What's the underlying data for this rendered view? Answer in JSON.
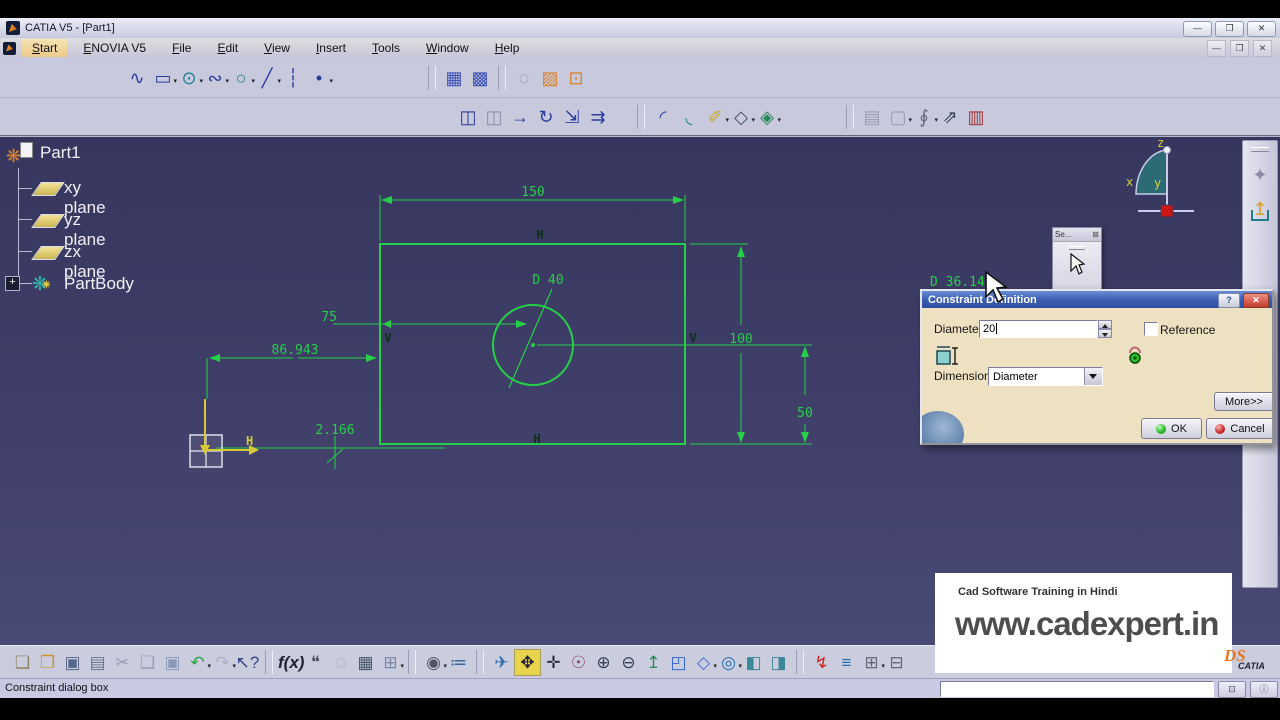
{
  "window": {
    "title": "CATIA V5 - [Part1]",
    "minimize": "—",
    "restore": "❐",
    "close": "✕"
  },
  "doc_window": {
    "minimize": "—",
    "restore": "❐",
    "close": "✕"
  },
  "menu": {
    "items": [
      {
        "name": "menu-start",
        "label": "Start",
        "cls": "active"
      },
      {
        "name": "menu-enovia",
        "label": "ENOVIA V5"
      },
      {
        "name": "menu-file",
        "label": "File"
      },
      {
        "name": "menu-edit",
        "label": "Edit"
      },
      {
        "name": "menu-view",
        "label": "View"
      },
      {
        "name": "menu-insert",
        "label": "Insert"
      },
      {
        "name": "menu-tools",
        "label": "Tools"
      },
      {
        "name": "menu-window",
        "label": "Window"
      },
      {
        "name": "menu-help",
        "label": "Help"
      }
    ]
  },
  "toolbars": {
    "sketch_profile": [
      {
        "name": "profile-icon",
        "glyph": "∿",
        "color": "#2a3c9e"
      },
      {
        "name": "rectangle-icon",
        "glyph": "▭",
        "color": "#2a3c9e",
        "cls": "dd"
      },
      {
        "name": "circle-icon",
        "glyph": "⊙",
        "color": "#1f7d8c",
        "cls": "dd"
      },
      {
        "name": "spline-icon",
        "glyph": "∾",
        "color": "#2a3c9e",
        "cls": "dd"
      },
      {
        "name": "ellipse-icon",
        "glyph": "○",
        "color": "#1f7d8c",
        "cls": "dd"
      },
      {
        "name": "line-icon",
        "glyph": "╱",
        "color": "#2a3c9e",
        "cls": "dd"
      },
      {
        "name": "axis-icon",
        "glyph": "┆",
        "color": "#2a3c9e"
      },
      {
        "name": "point-icon",
        "glyph": "•",
        "color": "#2a3c9e",
        "cls": "dd"
      },
      {
        "sep": true,
        "cls": "gap1"
      },
      {
        "name": "grid-icon",
        "glyph": "▦",
        "color": "#3a50b4"
      },
      {
        "name": "snap-to-point-icon",
        "glyph": "▩",
        "color": "#3a50b4"
      },
      {
        "sep": true
      },
      {
        "name": "construction-element-icon",
        "glyph": "◌",
        "color": "#8a8aa0"
      },
      {
        "name": "diagnostics-icon",
        "glyph": "▨",
        "color": "#d9822b"
      },
      {
        "name": "sketch-analysis-icon",
        "glyph": "⊡",
        "color": "#d9822b"
      }
    ],
    "operation": [
      {
        "name": "mirror-icon",
        "glyph": "◫",
        "color": "#2a3c9e"
      },
      {
        "name": "symmetry-icon",
        "glyph": "◫",
        "color": "#8890ac"
      },
      {
        "name": "translate-icon",
        "glyph": "→",
        "color": "#2a3c9e"
      },
      {
        "name": "rotate-icon",
        "glyph": "↻",
        "color": "#2a3c9e"
      },
      {
        "name": "scale-icon",
        "glyph": "⇲",
        "color": "#2a3c9e"
      },
      {
        "name": "offset-icon",
        "glyph": "⇉",
        "color": "#2a3c9e"
      },
      {
        "sep": true,
        "cls": "gap2"
      },
      {
        "name": "corner-icon",
        "glyph": "◜",
        "color": "#2a3c9e"
      },
      {
        "name": "chamfer-icon",
        "glyph": "◟",
        "color": "#1f7d8c"
      },
      {
        "name": "trim-icon",
        "glyph": "✐",
        "color": "#c8a828",
        "cls": "dd"
      },
      {
        "name": "constraint-icon",
        "glyph": "◇",
        "color": "#445566",
        "cls": "dd"
      },
      {
        "name": "animate-constraint-icon",
        "glyph": "◈",
        "color": "#2a8858",
        "cls": "dd"
      },
      {
        "sep": true,
        "cls": "gap3"
      },
      {
        "name": "catalog-icon",
        "glyph": "▤",
        "color": "#9a9ab0"
      },
      {
        "name": "parameters-icon",
        "glyph": "▢",
        "color": "#9a9ab0",
        "cls": "dd"
      },
      {
        "name": "attach-icon",
        "glyph": "∮",
        "color": "#666677",
        "cls": "dd"
      },
      {
        "name": "output-feature-icon",
        "glyph": "⇗",
        "color": "#334455"
      },
      {
        "name": "datum-icon",
        "glyph": "▥",
        "color": "#a03838"
      }
    ],
    "standard_view": [
      {
        "name": "new-icon",
        "glyph": "❏",
        "color": "#88885e"
      },
      {
        "name": "open-icon",
        "glyph": "❐",
        "color": "#c8962a"
      },
      {
        "name": "save-icon",
        "glyph": "▣",
        "color": "#556688"
      },
      {
        "name": "print-icon",
        "glyph": "▤",
        "color": "#667788"
      },
      {
        "name": "cut-icon",
        "glyph": "✂",
        "color": "#9a9ab0"
      },
      {
        "name": "copy-icon",
        "glyph": "❑",
        "color": "#9a9ab0"
      },
      {
        "name": "paste-icon",
        "glyph": "▣",
        "color": "#8898b8"
      },
      {
        "name": "undo-icon",
        "glyph": "↶",
        "color": "#28a048",
        "cls": "dd"
      },
      {
        "name": "redo-icon",
        "glyph": "↷",
        "color": "#b0b0c4",
        "cls": "dd"
      },
      {
        "name": "whats-this-icon",
        "glyph": "↖?",
        "color": "#334488",
        "cls": "w2"
      },
      {
        "sep": true
      },
      {
        "name": "formula-icon",
        "glyph": "f(x)",
        "color": "#222233",
        "cls": "fx"
      },
      {
        "name": "knowledge-icon",
        "glyph": "❝",
        "color": "#555566"
      },
      {
        "name": "knowledge-inspector-icon",
        "glyph": "☺",
        "color": "#b0b0c4"
      },
      {
        "name": "design-table-icon",
        "glyph": "▦",
        "color": "#445566"
      },
      {
        "name": "structure-icon",
        "glyph": "⊞",
        "color": "#7788aa",
        "cls": "dd"
      },
      {
        "sep": true
      },
      {
        "name": "lock-icon",
        "glyph": "◉",
        "color": "#555566",
        "cls": "dd"
      },
      {
        "name": "check-rules-icon",
        "glyph": "≔",
        "color": "#336699"
      },
      {
        "sep": true
      },
      {
        "name": "fly-mode-icon",
        "glyph": "✈",
        "color": "#2a6fb0"
      },
      {
        "name": "fit-all-icon",
        "glyph": "✥",
        "color": "#222233",
        "cls": "ybg"
      },
      {
        "name": "pan-icon",
        "glyph": "✛",
        "color": "#222233"
      },
      {
        "name": "rotate-view-icon",
        "glyph": "☉",
        "color": "#884466"
      },
      {
        "name": "zoom-in-icon",
        "glyph": "⊕",
        "color": "#334455"
      },
      {
        "name": "zoom-out-icon",
        "glyph": "⊖",
        "color": "#334455"
      },
      {
        "name": "normal-view-icon",
        "glyph": "↥",
        "color": "#2a8858"
      },
      {
        "name": "multi-view-icon",
        "glyph": "◰",
        "color": "#3366cc"
      },
      {
        "name": "iso-view-icon",
        "glyph": "◇",
        "color": "#3a6fd0",
        "cls": "dd"
      },
      {
        "name": "render-style-icon",
        "glyph": "◎",
        "color": "#2a6fb0",
        "cls": "dd"
      },
      {
        "name": "shading-icon",
        "glyph": "◧",
        "color": "#3a8898"
      },
      {
        "name": "wireframe-icon",
        "glyph": "◨",
        "color": "#3a8898"
      },
      {
        "sep": true
      },
      {
        "name": "hide-show-icon",
        "glyph": "↯",
        "color": "#cc2222"
      },
      {
        "name": "swap-visible-space-icon",
        "glyph": "≡",
        "color": "#2a6fb0"
      },
      {
        "name": "graph-tree-icon",
        "glyph": "⊞",
        "color": "#666677",
        "cls": "dd"
      },
      {
        "name": "graph-tree-reframe-icon",
        "glyph": "⊟",
        "color": "#666677"
      }
    ],
    "right": [
      {
        "name": "sketch-solving-status-icon",
        "glyph": "✦",
        "color": "#8a8aa0"
      },
      {
        "name": "exit-workbench-icon",
        "glyph": "↥",
        "color": "#d8a020",
        "cls": "exitwb"
      }
    ]
  },
  "tree": {
    "root": "Part1",
    "items": [
      {
        "label": "xy plane"
      },
      {
        "label": "yz plane"
      },
      {
        "label": "zx plane"
      },
      {
        "label": "PartBody"
      }
    ]
  },
  "sketch": {
    "width_dim": "150",
    "height_dim": "100",
    "offset_dim": "50",
    "center_dim": "75",
    "origin_x_dim": "86.943",
    "origin_y_dim": "2.166",
    "diameter_dim": "D 40",
    "clipped_dim": "D 36.14",
    "h_label": "H",
    "v_label": "V",
    "origin_h_label": "H",
    "colors": {
      "geometry": "#25d046",
      "axis": "#d9c937",
      "background_top": "#36365e",
      "background_bottom": "#4b4b78"
    }
  },
  "compass": {
    "x": "x",
    "y": "y",
    "z": "z"
  },
  "select_palette": {
    "title": "Se...",
    "close": "⊠"
  },
  "dialog": {
    "title": "Constraint Definition",
    "help": "?",
    "close": "✕",
    "diameter": {
      "label": "Diameter",
      "value": "20"
    },
    "reference": {
      "label": "Reference",
      "checked": false
    },
    "dimension": {
      "label": "Dimension",
      "value": "Diameter"
    },
    "more_label": "More>>",
    "ok_label": "OK",
    "cancel_label": "Cancel",
    "colors": {
      "background": "#eee1c1",
      "titlebar": "#3a5cb0"
    }
  },
  "watermark": {
    "line1": "Cad Software Training in Hindi",
    "line2": "www.cadexpert.in"
  },
  "logo": {
    "ds": "DS",
    "name": "CATIA"
  },
  "status": {
    "message": "Constraint dialog box"
  }
}
